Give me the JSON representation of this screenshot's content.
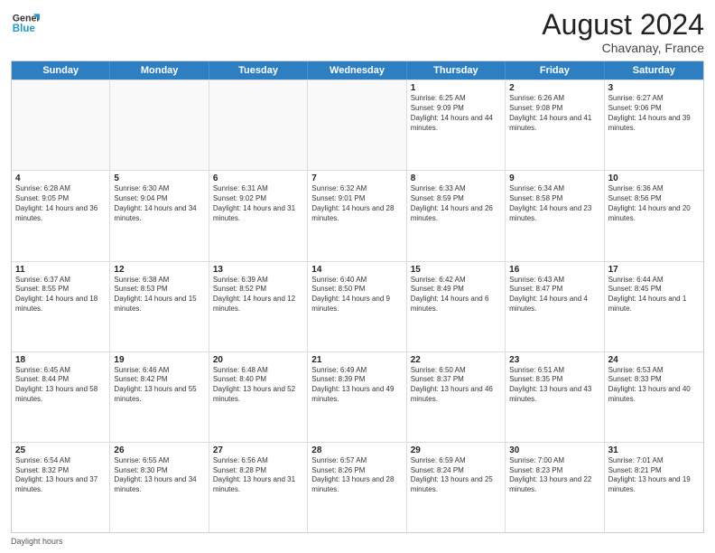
{
  "header": {
    "month_year": "August 2024",
    "location": "Chavanay, France"
  },
  "logo": {
    "line1": "General",
    "line2": "Blue"
  },
  "days": [
    "Sunday",
    "Monday",
    "Tuesday",
    "Wednesday",
    "Thursday",
    "Friday",
    "Saturday"
  ],
  "weeks": [
    [
      {
        "day": "",
        "empty": true
      },
      {
        "day": "",
        "empty": true
      },
      {
        "day": "",
        "empty": true
      },
      {
        "day": "",
        "empty": true
      },
      {
        "day": "1",
        "sunrise": "Sunrise: 6:25 AM",
        "sunset": "Sunset: 9:09 PM",
        "daylight": "Daylight: 14 hours and 44 minutes."
      },
      {
        "day": "2",
        "sunrise": "Sunrise: 6:26 AM",
        "sunset": "Sunset: 9:08 PM",
        "daylight": "Daylight: 14 hours and 41 minutes."
      },
      {
        "day": "3",
        "sunrise": "Sunrise: 6:27 AM",
        "sunset": "Sunset: 9:06 PM",
        "daylight": "Daylight: 14 hours and 39 minutes."
      }
    ],
    [
      {
        "day": "4",
        "sunrise": "Sunrise: 6:28 AM",
        "sunset": "Sunset: 9:05 PM",
        "daylight": "Daylight: 14 hours and 36 minutes."
      },
      {
        "day": "5",
        "sunrise": "Sunrise: 6:30 AM",
        "sunset": "Sunset: 9:04 PM",
        "daylight": "Daylight: 14 hours and 34 minutes."
      },
      {
        "day": "6",
        "sunrise": "Sunrise: 6:31 AM",
        "sunset": "Sunset: 9:02 PM",
        "daylight": "Daylight: 14 hours and 31 minutes."
      },
      {
        "day": "7",
        "sunrise": "Sunrise: 6:32 AM",
        "sunset": "Sunset: 9:01 PM",
        "daylight": "Daylight: 14 hours and 28 minutes."
      },
      {
        "day": "8",
        "sunrise": "Sunrise: 6:33 AM",
        "sunset": "Sunset: 8:59 PM",
        "daylight": "Daylight: 14 hours and 26 minutes."
      },
      {
        "day": "9",
        "sunrise": "Sunrise: 6:34 AM",
        "sunset": "Sunset: 8:58 PM",
        "daylight": "Daylight: 14 hours and 23 minutes."
      },
      {
        "day": "10",
        "sunrise": "Sunrise: 6:36 AM",
        "sunset": "Sunset: 8:56 PM",
        "daylight": "Daylight: 14 hours and 20 minutes."
      }
    ],
    [
      {
        "day": "11",
        "sunrise": "Sunrise: 6:37 AM",
        "sunset": "Sunset: 8:55 PM",
        "daylight": "Daylight: 14 hours and 18 minutes."
      },
      {
        "day": "12",
        "sunrise": "Sunrise: 6:38 AM",
        "sunset": "Sunset: 8:53 PM",
        "daylight": "Daylight: 14 hours and 15 minutes."
      },
      {
        "day": "13",
        "sunrise": "Sunrise: 6:39 AM",
        "sunset": "Sunset: 8:52 PM",
        "daylight": "Daylight: 14 hours and 12 minutes."
      },
      {
        "day": "14",
        "sunrise": "Sunrise: 6:40 AM",
        "sunset": "Sunset: 8:50 PM",
        "daylight": "Daylight: 14 hours and 9 minutes."
      },
      {
        "day": "15",
        "sunrise": "Sunrise: 6:42 AM",
        "sunset": "Sunset: 8:49 PM",
        "daylight": "Daylight: 14 hours and 6 minutes."
      },
      {
        "day": "16",
        "sunrise": "Sunrise: 6:43 AM",
        "sunset": "Sunset: 8:47 PM",
        "daylight": "Daylight: 14 hours and 4 minutes."
      },
      {
        "day": "17",
        "sunrise": "Sunrise: 6:44 AM",
        "sunset": "Sunset: 8:45 PM",
        "daylight": "Daylight: 14 hours and 1 minute."
      }
    ],
    [
      {
        "day": "18",
        "sunrise": "Sunrise: 6:45 AM",
        "sunset": "Sunset: 8:44 PM",
        "daylight": "Daylight: 13 hours and 58 minutes."
      },
      {
        "day": "19",
        "sunrise": "Sunrise: 6:46 AM",
        "sunset": "Sunset: 8:42 PM",
        "daylight": "Daylight: 13 hours and 55 minutes."
      },
      {
        "day": "20",
        "sunrise": "Sunrise: 6:48 AM",
        "sunset": "Sunset: 8:40 PM",
        "daylight": "Daylight: 13 hours and 52 minutes."
      },
      {
        "day": "21",
        "sunrise": "Sunrise: 6:49 AM",
        "sunset": "Sunset: 8:39 PM",
        "daylight": "Daylight: 13 hours and 49 minutes."
      },
      {
        "day": "22",
        "sunrise": "Sunrise: 6:50 AM",
        "sunset": "Sunset: 8:37 PM",
        "daylight": "Daylight: 13 hours and 46 minutes."
      },
      {
        "day": "23",
        "sunrise": "Sunrise: 6:51 AM",
        "sunset": "Sunset: 8:35 PM",
        "daylight": "Daylight: 13 hours and 43 minutes."
      },
      {
        "day": "24",
        "sunrise": "Sunrise: 6:53 AM",
        "sunset": "Sunset: 8:33 PM",
        "daylight": "Daylight: 13 hours and 40 minutes."
      }
    ],
    [
      {
        "day": "25",
        "sunrise": "Sunrise: 6:54 AM",
        "sunset": "Sunset: 8:32 PM",
        "daylight": "Daylight: 13 hours and 37 minutes."
      },
      {
        "day": "26",
        "sunrise": "Sunrise: 6:55 AM",
        "sunset": "Sunset: 8:30 PM",
        "daylight": "Daylight: 13 hours and 34 minutes."
      },
      {
        "day": "27",
        "sunrise": "Sunrise: 6:56 AM",
        "sunset": "Sunset: 8:28 PM",
        "daylight": "Daylight: 13 hours and 31 minutes."
      },
      {
        "day": "28",
        "sunrise": "Sunrise: 6:57 AM",
        "sunset": "Sunset: 8:26 PM",
        "daylight": "Daylight: 13 hours and 28 minutes."
      },
      {
        "day": "29",
        "sunrise": "Sunrise: 6:59 AM",
        "sunset": "Sunset: 8:24 PM",
        "daylight": "Daylight: 13 hours and 25 minutes."
      },
      {
        "day": "30",
        "sunrise": "Sunrise: 7:00 AM",
        "sunset": "Sunset: 8:23 PM",
        "daylight": "Daylight: 13 hours and 22 minutes."
      },
      {
        "day": "31",
        "sunrise": "Sunrise: 7:01 AM",
        "sunset": "Sunset: 8:21 PM",
        "daylight": "Daylight: 13 hours and 19 minutes."
      }
    ]
  ],
  "footer": {
    "daylight_label": "Daylight hours"
  }
}
